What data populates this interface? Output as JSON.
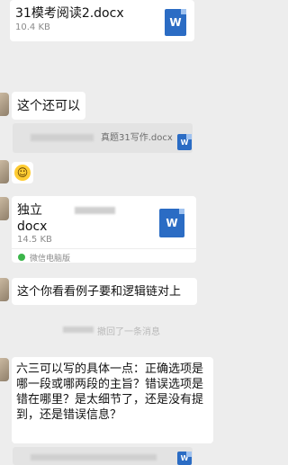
{
  "messages": {
    "file1": {
      "name": "31模考阅读2.docx",
      "size": "10.4 KB",
      "icon": "W"
    },
    "text1": "这个还可以",
    "file_quote1": {
      "name": "真题31写作.docx",
      "icon": "W"
    },
    "emoji1": "😁",
    "file2": {
      "name_line1": "独立",
      "name_line2": "docx",
      "size": "14.5 KB",
      "source": "微信电脑版",
      "icon": "W"
    },
    "text2": "这个你看看例子要和逻辑链对上",
    "system_note": "撤回了一条消息",
    "text3": "六三可以写的具体一点：正确选项是哪一段或哪两段的主旨？错误选项是错在哪里？是太细节了，还是没有提到，还是错误信息？",
    "file_quote2": {
      "icon": "W"
    }
  }
}
